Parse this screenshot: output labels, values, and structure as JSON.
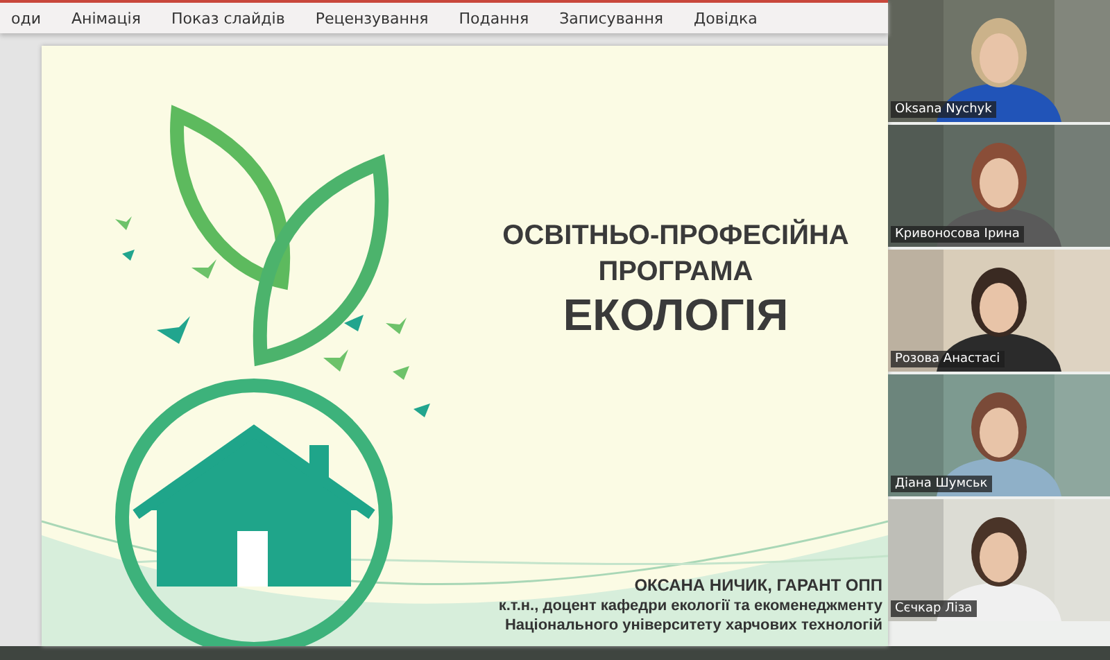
{
  "ribbon": {
    "tabs": [
      {
        "label": "оди"
      },
      {
        "label": "Анімація"
      },
      {
        "label": "Показ слайдів"
      },
      {
        "label": "Рецензування"
      },
      {
        "label": "Подання"
      },
      {
        "label": "Записування"
      },
      {
        "label": "Довідка"
      }
    ]
  },
  "slide": {
    "title_lines": [
      "ОСВІТНЬО-ПРОФЕСІЙНА",
      "ПРОГРАМА"
    ],
    "subject": "ЕКОЛОГІЯ",
    "author": "ОКСАНА НИЧИК, ГАРАНТ ОПП",
    "position": "к.т.н., доцент кафедри екології та екоменеджменту",
    "university": "Національного університету харчових технологій"
  },
  "participants": [
    {
      "name": "Oksana Nychyk",
      "kind": "picture"
    },
    {
      "name": "Кривоносова Ірина",
      "kind": "picture"
    },
    {
      "name": "Розова Анастасі",
      "kind": "picture"
    },
    {
      "name": "Діана Шумськ",
      "kind": "picture"
    },
    {
      "name": "Сєчкар Ліза",
      "kind": "picture"
    }
  ]
}
